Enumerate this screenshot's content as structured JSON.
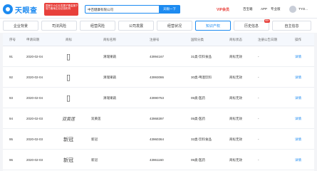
{
  "header": {
    "logo_text": "天眼查",
    "promo_lines": [
      "国家中小企业发展子基金旗下",
      "官方备案企业征信机构"
    ],
    "search_value": "中百健康有限公司",
    "search_button": "天眼一下",
    "nav": {
      "vip": "VIP会员",
      "enterprise": "百宝箱",
      "app": "APP",
      "pro": "专业版",
      "service": "服务中心",
      "user": "TYO..."
    }
  },
  "tabs": [
    {
      "label": "企业背景"
    },
    {
      "label": "司法风险"
    },
    {
      "label": "经营风险"
    },
    {
      "label": "公司发展"
    },
    {
      "label": "经营状况"
    },
    {
      "label": "知识产权",
      "active": true
    },
    {
      "label": "历史信息",
      "badge": "99+"
    },
    {
      "label": "自主信息"
    }
  ],
  "table": {
    "columns": [
      "序号",
      "申请日期",
      "商标",
      "商标名称",
      "注册号",
      "国际分类",
      "商标状态",
      "注册公告日期",
      "操作"
    ],
    "rows": [
      {
        "index": "91",
        "date": "2020-02-04",
        "mark": "清瑞果蔬",
        "mark_glyph": "▯",
        "name": "清瑞果蔬",
        "reg": "43994167",
        "class": "31类-饮料食品",
        "status": "商标无效",
        "pub": "-",
        "action": "详情"
      },
      {
        "index": "92",
        "date": "2020-02-04",
        "mark": "清瑞果蔬",
        "mark_glyph": "▯",
        "name": "清瑞果蔬",
        "reg": "43993086",
        "class": "30类-啤酒饮料",
        "status": "商标无效",
        "pub": "-",
        "action": "详情"
      },
      {
        "index": "93",
        "date": "2020-02-04",
        "mark": "清瑞果蔬",
        "mark_glyph": "▯",
        "name": "清瑞果蔬",
        "reg": "43990753",
        "class": "05类-医药",
        "status": "商标无效",
        "pub": "-",
        "action": "详情"
      },
      {
        "index": "94",
        "date": "2020-02-03",
        "mark": "双黄莲",
        "mark_glyph": "双黄莲",
        "name": "双黄莲",
        "reg": "43968397",
        "class": "05类-医药",
        "status": "商标无效",
        "pub": "-",
        "action": "详情"
      },
      {
        "index": "95",
        "date": "2020-02-03",
        "mark": "新冠",
        "mark_glyph": "新冠",
        "name": "新冠",
        "reg": "43960364",
        "class": "32类-饮料食品",
        "status": "商标无效",
        "pub": "-",
        "action": "详情"
      },
      {
        "index": "96",
        "date": "2020-02-03",
        "mark": "新冠",
        "mark_glyph": "新冠",
        "name": "新冠",
        "reg": "43961160",
        "class": "05类-医药",
        "status": "商标无效",
        "pub": "-",
        "action": "详情"
      }
    ]
  }
}
